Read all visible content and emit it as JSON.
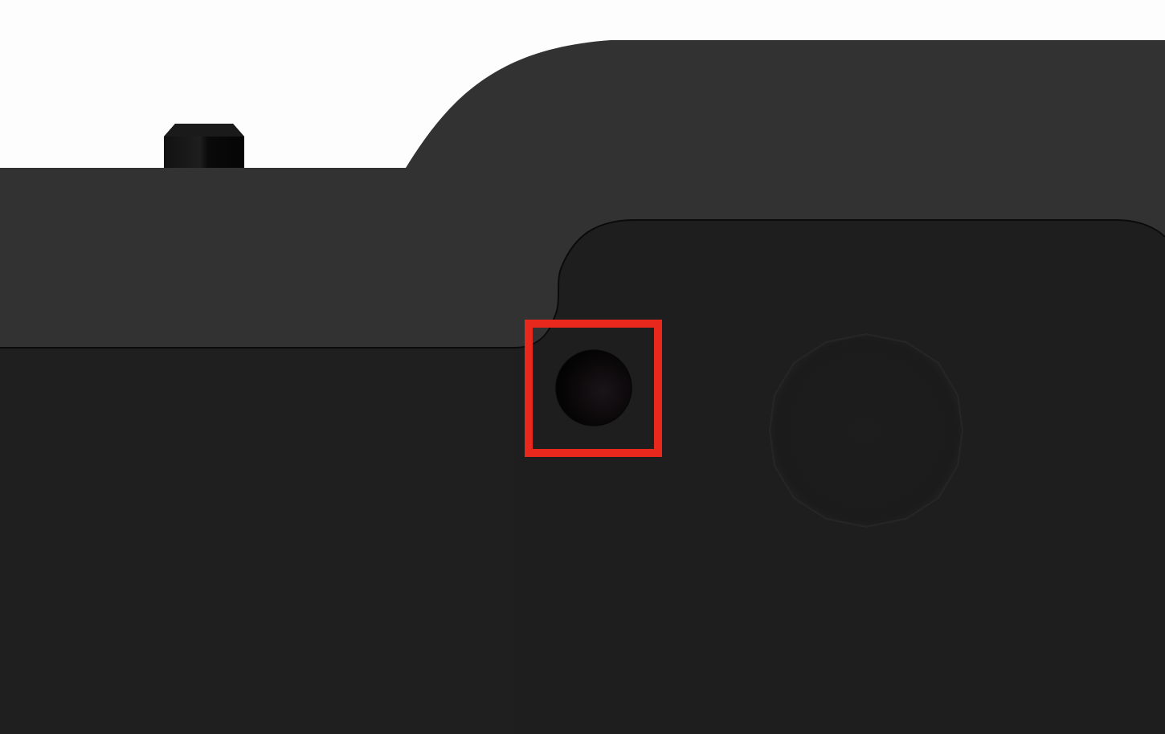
{
  "image": {
    "subject": "device-corner-closeup",
    "colors": {
      "background": "#fdfdfd",
      "outer_shell": "#323232",
      "lower_body": "#1f1f1f",
      "raised_panel": "#1e1e1e",
      "edge_line": "#0b0b0b",
      "pin": "#0c0c0c",
      "pin_highlight": "#2a2a2a",
      "hole_dark": "#050505",
      "hole_mid": "#140f13",
      "recess": "#1b1b1b",
      "recess_edge": "#262626",
      "highlight_box": "#e8281c"
    },
    "parts": [
      {
        "name": "top-pin",
        "icon": "pin-icon"
      },
      {
        "name": "small-hole",
        "icon": "hole-icon",
        "highlighted": true
      },
      {
        "name": "circular-recess",
        "icon": "circle-icon"
      }
    ]
  }
}
